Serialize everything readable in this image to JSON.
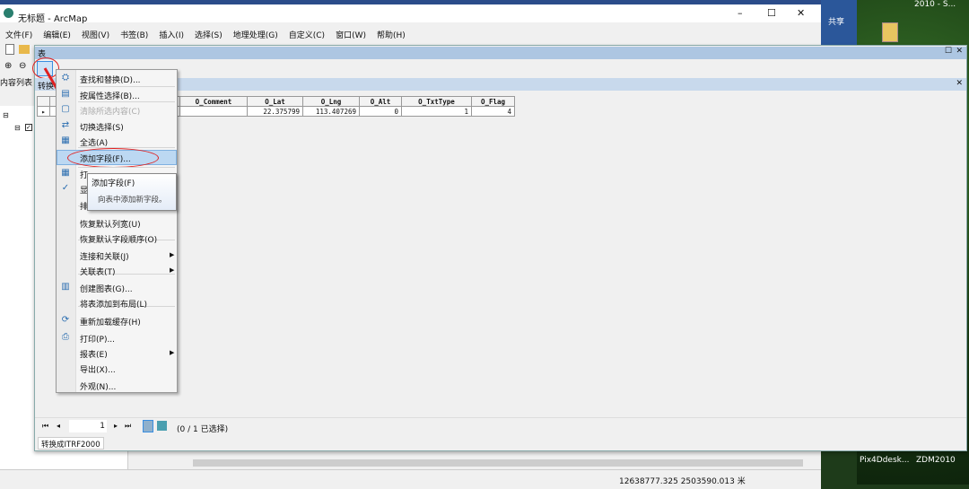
{
  "window": {
    "title": "无标题 - ArcMap",
    "min": "–",
    "max": "☐",
    "close": "✕"
  },
  "menubar": [
    "文件(F)",
    "编辑(E)",
    "视图(V)",
    "书签(B)",
    "插入(I)",
    "选择(S)",
    "地理处理(G)",
    "自定义(C)",
    "窗口(W)",
    "帮助(H)"
  ],
  "word": {
    "share": "共享"
  },
  "desktop": {
    "top_label": "2010 - S...",
    "taskbar": [
      "Pix4Ddesk...",
      "ZDM2010"
    ]
  },
  "toc": {
    "label": "内容列表"
  },
  "table_window": {
    "title": "表",
    "tab_header": "转换",
    "columns": [
      "O_Comment",
      "O_Lat",
      "O_Lng",
      "O_Alt",
      "O_TxtType",
      "O_Flag"
    ],
    "rows": [
      [
        "",
        "22.375799",
        "113.407269",
        "0",
        "1",
        "4"
      ]
    ],
    "nav": {
      "record": "1",
      "selection": "(0 / 1 已选择)"
    },
    "tab": "转换成ITRF2000"
  },
  "menu": {
    "items": [
      {
        "label": "查找和替换(D)...",
        "icon": "binoculars-icon"
      },
      {
        "label": "按属性选择(B)...",
        "icon": "select-by-attributes-icon"
      },
      {
        "label": "清除所选内容(C)",
        "icon": "clear-selection-icon",
        "disabled": true
      },
      {
        "label": "切换选择(S)",
        "icon": "switch-selection-icon"
      },
      {
        "label": "全选(A)",
        "icon": "select-all-icon"
      },
      {
        "label": "添加字段(F)...",
        "highlighted": true
      },
      {
        "label": "打",
        "icon": "table-icon"
      },
      {
        "label": "显",
        "icon": "check-icon"
      },
      {
        "label": "排"
      },
      {
        "label": "恢复默认列宽(U)"
      },
      {
        "label": "恢复默认字段顺序(O)"
      },
      {
        "label": "连接和关联(J)",
        "submenu": true
      },
      {
        "label": "关联表(T)",
        "submenu": true
      },
      {
        "label": "创建图表(G)...",
        "icon": "chart-icon"
      },
      {
        "label": "将表添加到布局(L)"
      },
      {
        "label": "重新加载缓存(H)",
        "icon": "refresh-icon"
      },
      {
        "label": "打印(P)...",
        "icon": "printer-icon"
      },
      {
        "label": "报表(E)",
        "submenu": true
      },
      {
        "label": "导出(X)..."
      },
      {
        "label": "外观(N)..."
      }
    ]
  },
  "tooltip": {
    "title": "添加字段(F)",
    "desc": "向表中添加新字段。"
  },
  "status": {
    "coords": "12638777.325  2503590.013 米"
  },
  "colors": {
    "title_bar": "#adc6e2",
    "highlight": "#bcd8f2",
    "annotation": "#e02020"
  }
}
